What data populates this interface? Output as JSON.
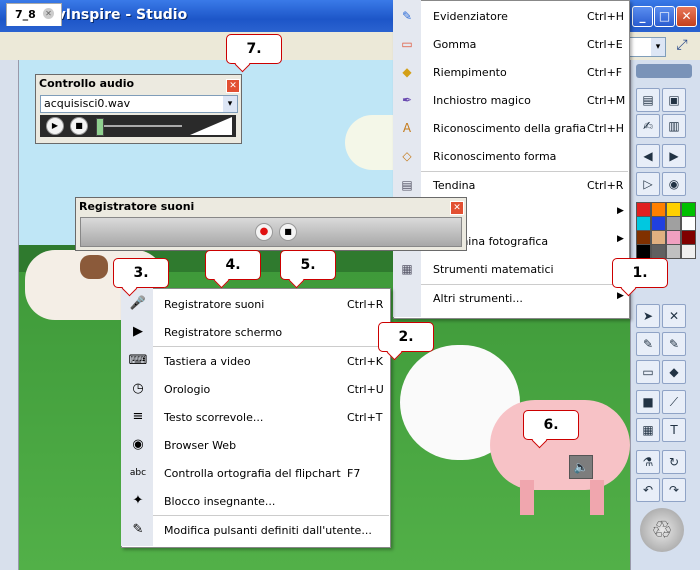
{
  "window": {
    "title": "ActivInspire - Studio",
    "minimize": "_",
    "maximize": "□",
    "close": "✕"
  },
  "tab": {
    "label": "7_8",
    "close": "✕"
  },
  "audio_control": {
    "title": "Controllo audio",
    "close": "✕",
    "file": "acquisisci0.wav",
    "arrow": "▾"
  },
  "recorder": {
    "title": "Registratore suoni",
    "close": "✕"
  },
  "menu_right": {
    "items": [
      {
        "label": "Evidenziatore",
        "shortcut": "Ctrl+H",
        "icon": "highlighter-icon",
        "glyph": "✎",
        "color": "#2a6ad8"
      },
      {
        "label": "Gomma",
        "shortcut": "Ctrl+E",
        "icon": "eraser-icon",
        "glyph": "▭",
        "color": "#e0563a"
      },
      {
        "label": "Riempimento",
        "shortcut": "Ctrl+F",
        "icon": "fill-icon",
        "glyph": "◆",
        "color": "#d4a017"
      },
      {
        "label": "Inchiostro magico",
        "shortcut": "Ctrl+M",
        "icon": "magic-ink-icon",
        "glyph": "✒",
        "color": "#6a4ab0"
      },
      {
        "label": "Riconoscimento della grafia",
        "shortcut": "Ctrl+H",
        "icon": "handwriting-icon",
        "glyph": "A",
        "color": "#c47a1a"
      },
      {
        "label": "Riconoscimento forma",
        "shortcut": "",
        "icon": "shape-recognition-icon",
        "glyph": "◇",
        "color": "#c47a1a"
      },
      {
        "label": "Tendina",
        "shortcut": "Ctrl+R",
        "icon": "curtain-icon",
        "glyph": "▤",
        "color": "#556"
      },
      {
        "label": "re",
        "shortcut": "",
        "icon": "spotlight-icon",
        "glyph": "◎",
        "color": "#556",
        "submenu": true
      },
      {
        "label": "Macchina fotografica",
        "shortcut": "",
        "icon": "camera-icon",
        "glyph": "▣",
        "color": "#556",
        "submenu": true
      },
      {
        "label": "Strumenti matematici",
        "shortcut": "",
        "icon": "calculator-icon",
        "glyph": "▦",
        "color": "#556"
      },
      {
        "label": "Altri strumenti...",
        "shortcut": "",
        "icon": "more-tools-icon",
        "glyph": "",
        "color": "#556",
        "submenu": true
      }
    ],
    "arrow": "▶"
  },
  "menu_left": {
    "items": [
      {
        "label": "Registratore suoni",
        "shortcut": "Ctrl+R",
        "icon": "microphone-icon",
        "glyph": "🎤"
      },
      {
        "label": "Registratore schermo",
        "shortcut": "",
        "icon": "video-camera-icon",
        "glyph": "▶"
      },
      {
        "label": "Tastiera a video",
        "shortcut": "Ctrl+K",
        "icon": "keyboard-icon",
        "glyph": "⌨"
      },
      {
        "label": "Orologio",
        "shortcut": "Ctrl+U",
        "icon": "clock-icon",
        "glyph": "◷"
      },
      {
        "label": "Testo scorrevole...",
        "shortcut": "Ctrl+T",
        "icon": "ticker-icon",
        "glyph": "≡"
      },
      {
        "label": "Browser Web",
        "shortcut": "",
        "icon": "globe-icon",
        "glyph": "◉"
      },
      {
        "label": "Controlla ortografia del flipchart",
        "shortcut": "F7",
        "icon": "spellcheck-icon",
        "glyph": "abc"
      },
      {
        "label": "Blocco insegnante...",
        "shortcut": "",
        "icon": "teacher-lock-icon",
        "glyph": "✦"
      },
      {
        "label": "Modifica pulsanti definiti dall'utente...",
        "shortcut": "",
        "icon": "user-buttons-icon",
        "glyph": "✎"
      }
    ]
  },
  "callouts": {
    "c1": "1.",
    "c2": "2.",
    "c3": "3.",
    "c4": "4.",
    "c5": "5.",
    "c6": "6.",
    "c7": "7."
  },
  "colors": {
    "accent": "#2a62d0",
    "swatches": [
      "#e02020",
      "#ff8000",
      "#ffd000",
      "#00c000",
      "#00c8e0",
      "#2040e0",
      "#a0a0a0",
      "#ffffff",
      "#803000",
      "#e0b080",
      "#f0a0c0",
      "#800000",
      "#000000",
      "#606060",
      "#c0c0c0",
      "#f0f0f0"
    ]
  }
}
